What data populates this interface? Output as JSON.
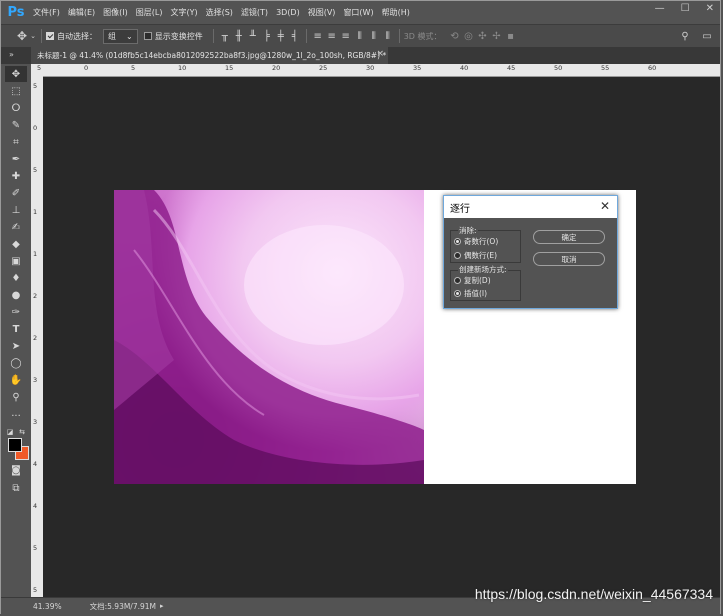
{
  "app": {
    "logo": "Ps"
  },
  "menubar": {
    "items": [
      "文件(F)",
      "编辑(E)",
      "图像(I)",
      "图层(L)",
      "文字(Y)",
      "选择(S)",
      "滤镜(T)",
      "3D(D)",
      "视图(V)",
      "窗口(W)",
      "帮助(H)"
    ]
  },
  "window_controls": {
    "minimize": "—",
    "restore": "☐",
    "close": "✕"
  },
  "options_bar": {
    "move_icon": "move-tool-icon",
    "auto_select_label": "自动选择：",
    "auto_select_checked": true,
    "auto_select_value": "组",
    "show_transform_label": "显示变换控件",
    "show_transform_checked": false,
    "mode_3d_label": "3D 模式："
  },
  "document_tab": {
    "title": "未标题-1 @ 41.4% (01d8fb5c14ebcba8012092522ba8f3.jpg@1280w_1l_2o_100sh, RGB/8#) *",
    "close": "×"
  },
  "ruler_top": [
    "5",
    "0",
    "5",
    "10",
    "15",
    "20",
    "25",
    "30",
    "35",
    "40",
    "45",
    "50",
    "55",
    "60"
  ],
  "ruler_left": [
    "5",
    "0",
    "5",
    "1",
    "1",
    "2",
    "2",
    "3",
    "3",
    "4",
    "4",
    "5",
    "5"
  ],
  "dialog": {
    "title": "逐行",
    "close": "✕",
    "eliminate_label": "消除:",
    "odd_rows": "奇数行(O)",
    "even_rows": "偶数行(E)",
    "eliminate_selected": "odd",
    "create_label": "创建新场方式:",
    "duplicate": "复制(D)",
    "interpolate": "插值(I)",
    "create_selected": "interpolate",
    "ok": "确定",
    "cancel": "取消"
  },
  "status_bar": {
    "zoom": "41.39%",
    "doc_info": "文档:5.93M/7.91M"
  },
  "watermark": "https://blog.csdn.net/weixin_44567334",
  "colors": {
    "foreground": "#000000",
    "background": "#f05a28",
    "accent": "#31a8ff"
  }
}
